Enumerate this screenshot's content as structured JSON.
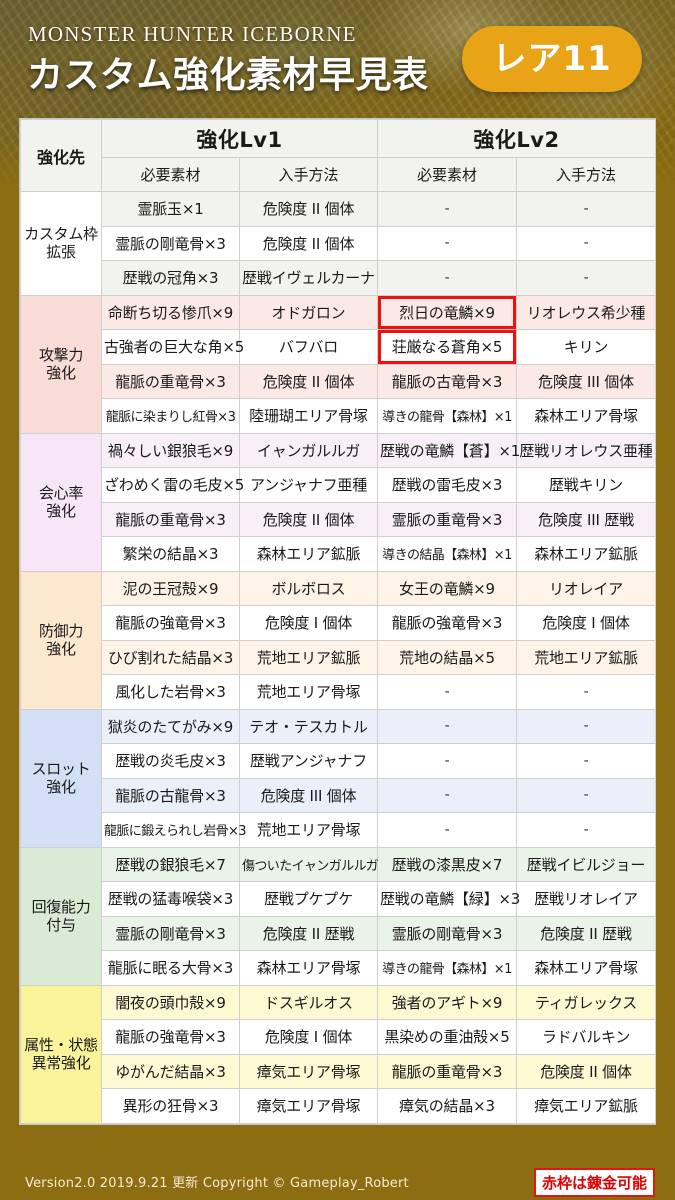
{
  "header": {
    "title_en": "MONSTER HUNTER ICEBORNE",
    "title_jp": "カスタム強化素材早見表",
    "rarity_badge": "レア11",
    "badge_color": "#e8a317"
  },
  "table": {
    "corner_header": "強化先",
    "level_headers": [
      "強化Lv1",
      "強化Lv2"
    ],
    "sub_headers": [
      "必要素材",
      "入手方法",
      "必要素材",
      "入手方法"
    ],
    "sections": [
      {
        "label": "カスタム枠\n拡張",
        "label_line1": "カスタム枠",
        "label_line2": "拡張",
        "color": "#ffffff",
        "tint": "#f2f2f0",
        "rows": [
          [
            "霊脈玉×1",
            "危険度 II 個体",
            "-",
            "-"
          ],
          [
            "霊脈の剛竜骨×3",
            "危険度 II 個体",
            "-",
            "-"
          ],
          [
            "歴戦の冠角×3",
            "歴戦イヴェルカーナ",
            "-",
            "-"
          ]
        ]
      },
      {
        "label_line1": "攻撃力",
        "label_line2": "強化",
        "color": "#fadcd6",
        "tint": "#fbe9e5",
        "rows": [
          [
            "命断ち切る惨爪×9",
            "オドガロン",
            "烈日の竜鱗×9",
            "リオレウス希少種"
          ],
          [
            "古強者の巨大な角×5",
            "バフバロ",
            "荘厳なる蒼角×5",
            "キリン"
          ],
          [
            "龍脈の重竜骨×3",
            "危険度 II 個体",
            "龍脈の古竜骨×3",
            "危険度 III 個体"
          ],
          [
            "龍脈に染まりし紅骨×3",
            "陸珊瑚エリア骨塚",
            "導きの龍骨【森林】×1",
            "森林エリア骨塚"
          ]
        ],
        "redbox_cells": [
          [
            0,
            2
          ],
          [
            1,
            2
          ]
        ]
      },
      {
        "label_line1": "会心率",
        "label_line2": "強化",
        "color": "#f7e6f7",
        "tint": "#f8eff8",
        "rows": [
          [
            "禍々しい銀狼毛×9",
            "イャンガルルガ",
            "歴戦の竜鱗【蒼】×1",
            "歴戦リオレウス亜種"
          ],
          [
            "ざわめく雷の毛皮×5",
            "アンジャナフ亜種",
            "歴戦の雷毛皮×3",
            "歴戦キリン"
          ],
          [
            "龍脈の重竜骨×3",
            "危険度 II 個体",
            "霊脈の重竜骨×3",
            "危険度 III 歴戦"
          ],
          [
            "繁栄の結晶×3",
            "森林エリア鉱脈",
            "導きの結晶【森林】×1",
            "森林エリア鉱脈"
          ]
        ],
        "redbox_cells": []
      },
      {
        "label_line1": "防御力",
        "label_line2": "強化",
        "color": "#fbe8cf",
        "tint": "#fdf3e7",
        "rows": [
          [
            "泥の王冠殻×9",
            "ボルボロス",
            "女王の竜鱗×9",
            "リオレイア"
          ],
          [
            "龍脈の強竜骨×3",
            "危険度 I 個体",
            "龍脈の強竜骨×3",
            "危険度 I 個体"
          ],
          [
            "ひび割れた結晶×3",
            "荒地エリア鉱脈",
            "荒地の結晶×5",
            "荒地エリア鉱脈"
          ],
          [
            "風化した岩骨×3",
            "荒地エリア骨塚",
            "-",
            "-"
          ]
        ],
        "redbox_cells": []
      },
      {
        "label_line1": "スロット",
        "label_line2": "強化",
        "color": "#d3dff4",
        "tint": "#eaeffa",
        "rows": [
          [
            "獄炎のたてがみ×9",
            "テオ・テスカトル",
            "-",
            "-"
          ],
          [
            "歴戦の炎毛皮×3",
            "歴戦アンジャナフ",
            "-",
            "-"
          ],
          [
            "龍脈の古龍骨×3",
            "危険度 III 個体",
            "-",
            "-"
          ],
          [
            "龍脈に鍛えられし岩骨×3",
            "荒地エリア骨塚",
            "-",
            "-"
          ]
        ],
        "redbox_cells": []
      },
      {
        "label_line1": "回復能力",
        "label_line2": "付与",
        "color": "#d9ebd5",
        "tint": "#eaf3e7",
        "rows": [
          [
            "歴戦の銀狼毛×7",
            "傷ついたイャンガルルガ",
            "歴戦の漆黒皮×7",
            "歴戦イビルジョー"
          ],
          [
            "歴戦の猛毒喉袋×3",
            "歴戦プケプケ",
            "歴戦の竜鱗【緑】×3",
            "歴戦リオレイア"
          ],
          [
            "霊脈の剛竜骨×3",
            "危険度 II 歴戦",
            "霊脈の剛竜骨×3",
            "危険度 II 歴戦"
          ],
          [
            "龍脈に眠る大骨×3",
            "森林エリア骨塚",
            "導きの龍骨【森林】×1",
            "森林エリア骨塚"
          ]
        ],
        "redbox_cells": []
      },
      {
        "label_line1": "属性・状態",
        "label_line2": "異常強化",
        "color": "#fbf39a",
        "tint": "#fdf9d2",
        "rows": [
          [
            "闇夜の頭巾殻×9",
            "ドスギルオス",
            "強者のアギト×9",
            "ティガレックス"
          ],
          [
            "龍脈の強竜骨×3",
            "危険度 I 個体",
            "黒染めの重油殻×5",
            "ラドバルキン"
          ],
          [
            "ゆがんだ結晶×3",
            "瘴気エリア骨塚",
            "龍脈の重竜骨×3",
            "危険度 II 個体"
          ],
          [
            "異形の狂骨×3",
            "瘴気エリア骨塚",
            "瘴気の結晶×3",
            "瘴気エリア鉱脈"
          ]
        ],
        "redbox_cells": []
      }
    ]
  },
  "footer": {
    "version": "Version2.0",
    "updated": "2019.9.21 更新",
    "copyright": "Copyright © Gameplay_Robert",
    "full_text": "Version2.0   2019.9.21 更新   Copyright © Gameplay_Robert",
    "legend": "赤枠は錬金可能",
    "legend_color": "#e00000"
  }
}
